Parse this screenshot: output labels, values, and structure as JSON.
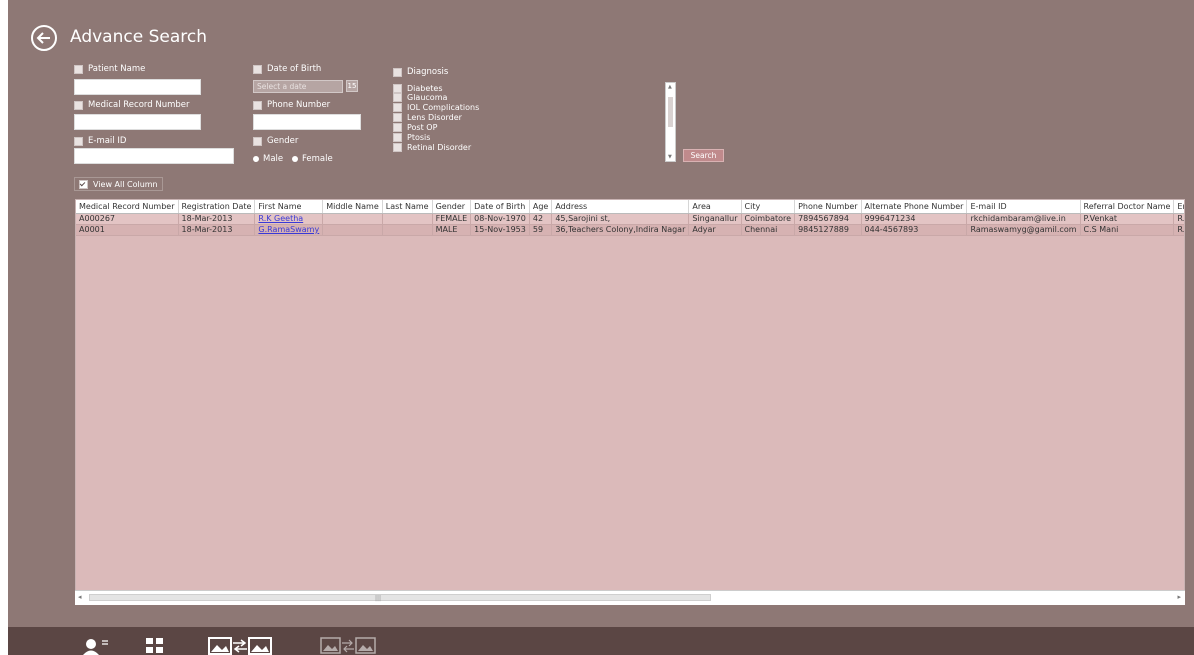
{
  "page": {
    "title": "Advance Search"
  },
  "filters": {
    "patient_name": "Patient Name",
    "mrn": "Medical Record Number",
    "email": "E-mail ID",
    "dob": "Date of Birth",
    "dob_placeholder": "Select a date",
    "dob_cal_icon": "15",
    "phone": "Phone Number",
    "gender": "Gender",
    "male": "Male",
    "female": "Female",
    "diagnosis": "Diagnosis",
    "diagnosis_options": [
      "Diabetes",
      "Glaucoma",
      "IOL Complications",
      "Lens Disorder",
      "Post OP",
      "Ptosis",
      "Retinal Disorder"
    ],
    "search": "Search",
    "view_all": "View All Column"
  },
  "table": {
    "columns": [
      "Medical Record Number",
      "Registration Date",
      "First Name",
      "Middle Name",
      "Last Name",
      "Gender",
      "Date of Birth",
      "Age",
      "Address",
      "Area",
      "City",
      "Phone Number",
      "Alternate Phone Number",
      "E-mail ID",
      "Referral Doctor Name",
      "Emer"
    ],
    "rows": [
      [
        "A000267",
        "18-Mar-2013",
        "R.K Geetha",
        "",
        "",
        "FEMALE",
        "08-Nov-1970",
        "42",
        "45,Sarojini st,",
        "Singanallur",
        "Coimbatore",
        "7894567894",
        "9996471234",
        "rkchidambaram@live.in",
        "P.Venkat",
        "R.K.G"
      ],
      [
        "A0001",
        "18-Mar-2013",
        "G.RamaSwamy",
        "",
        "",
        "MALE",
        "15-Nov-1953",
        "59",
        "36,Teachers Colony,Indira Nagar",
        "Adyar",
        "Chennai",
        "9845127889",
        "044-4567893",
        "Ramaswamyg@gamil.com",
        "C.S Mani",
        "R.Kan"
      ]
    ]
  },
  "colors": {
    "background": "#8e7875",
    "grid": "#dbbaba",
    "appbar": "#5b4644",
    "search_button": "#c08a8c",
    "link": "#3a39d6"
  },
  "appbar_icons": [
    "add-patient-icon",
    "grid-view-icon",
    "compare-images-icon",
    "compare-images-disabled-icon"
  ]
}
